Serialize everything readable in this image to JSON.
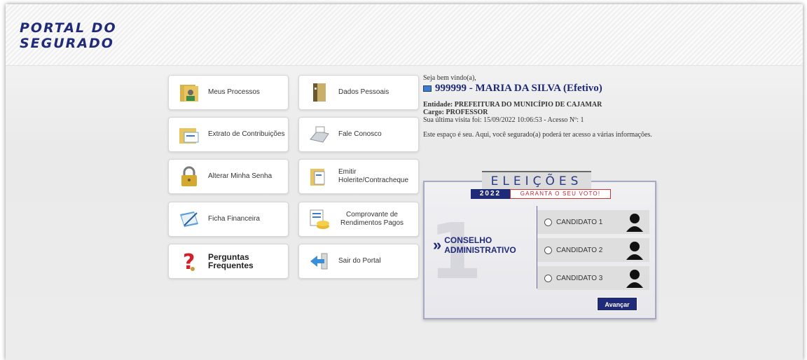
{
  "header": {
    "logo_line1": "PORTAL DO",
    "logo_line2": "SEGURADO"
  },
  "menu": [
    {
      "label": "Meus Processos",
      "icon": "folder-person-icon"
    },
    {
      "label": "Dados Pessoais",
      "icon": "binder-icon"
    },
    {
      "label": "Extrato de Contribuições",
      "icon": "folder-document-icon"
    },
    {
      "label": "Fale Conosco",
      "icon": "fax-icon"
    },
    {
      "label": "Alterar Minha Senha",
      "icon": "lock-icon"
    },
    {
      "label": "Emitir Holerite/Contracheque",
      "icon": "folder-doc-icon"
    },
    {
      "label": "Ficha Financeira",
      "icon": "notebook-pen-icon"
    },
    {
      "label": "Comprovante de Rendimentos Pagos",
      "icon": "coins-document-icon"
    },
    {
      "label": "Perguntas Frequentes",
      "icon": "question-icon"
    },
    {
      "label": "Sair do Portal",
      "icon": "exit-arrow-icon"
    }
  ],
  "welcome": {
    "greeting": "Seja bem vindo(a),",
    "user": "999999 - MARIA DA SILVA (Efetivo)",
    "entity": "Entidade: PREFEITURA DO MUNICÍPIO DE CAJAMAR",
    "role": "Cargo: PROFESSOR",
    "last_visit": "Sua última visita foi: 15/09/2022 10:06:53 - Acesso Nº: 1",
    "info": "Este espaço é seu. Aqui, você segurado(a) poderá ter acesso a várias informações."
  },
  "election": {
    "title": "ELEIÇÕES",
    "year": "2022",
    "slogan": "GARANTA O SEU VOTO!",
    "big_number": "1",
    "council_line1": "CONSELHO",
    "council_line2": "ADMINISTRATIVO",
    "candidates": [
      "CANDIDATO 1",
      "CANDIDATO 2",
      "CANDIDATO 3"
    ],
    "advance_label": "Avançar",
    "colors": {
      "navy": "#1f2a78",
      "red": "#c8202a"
    }
  }
}
